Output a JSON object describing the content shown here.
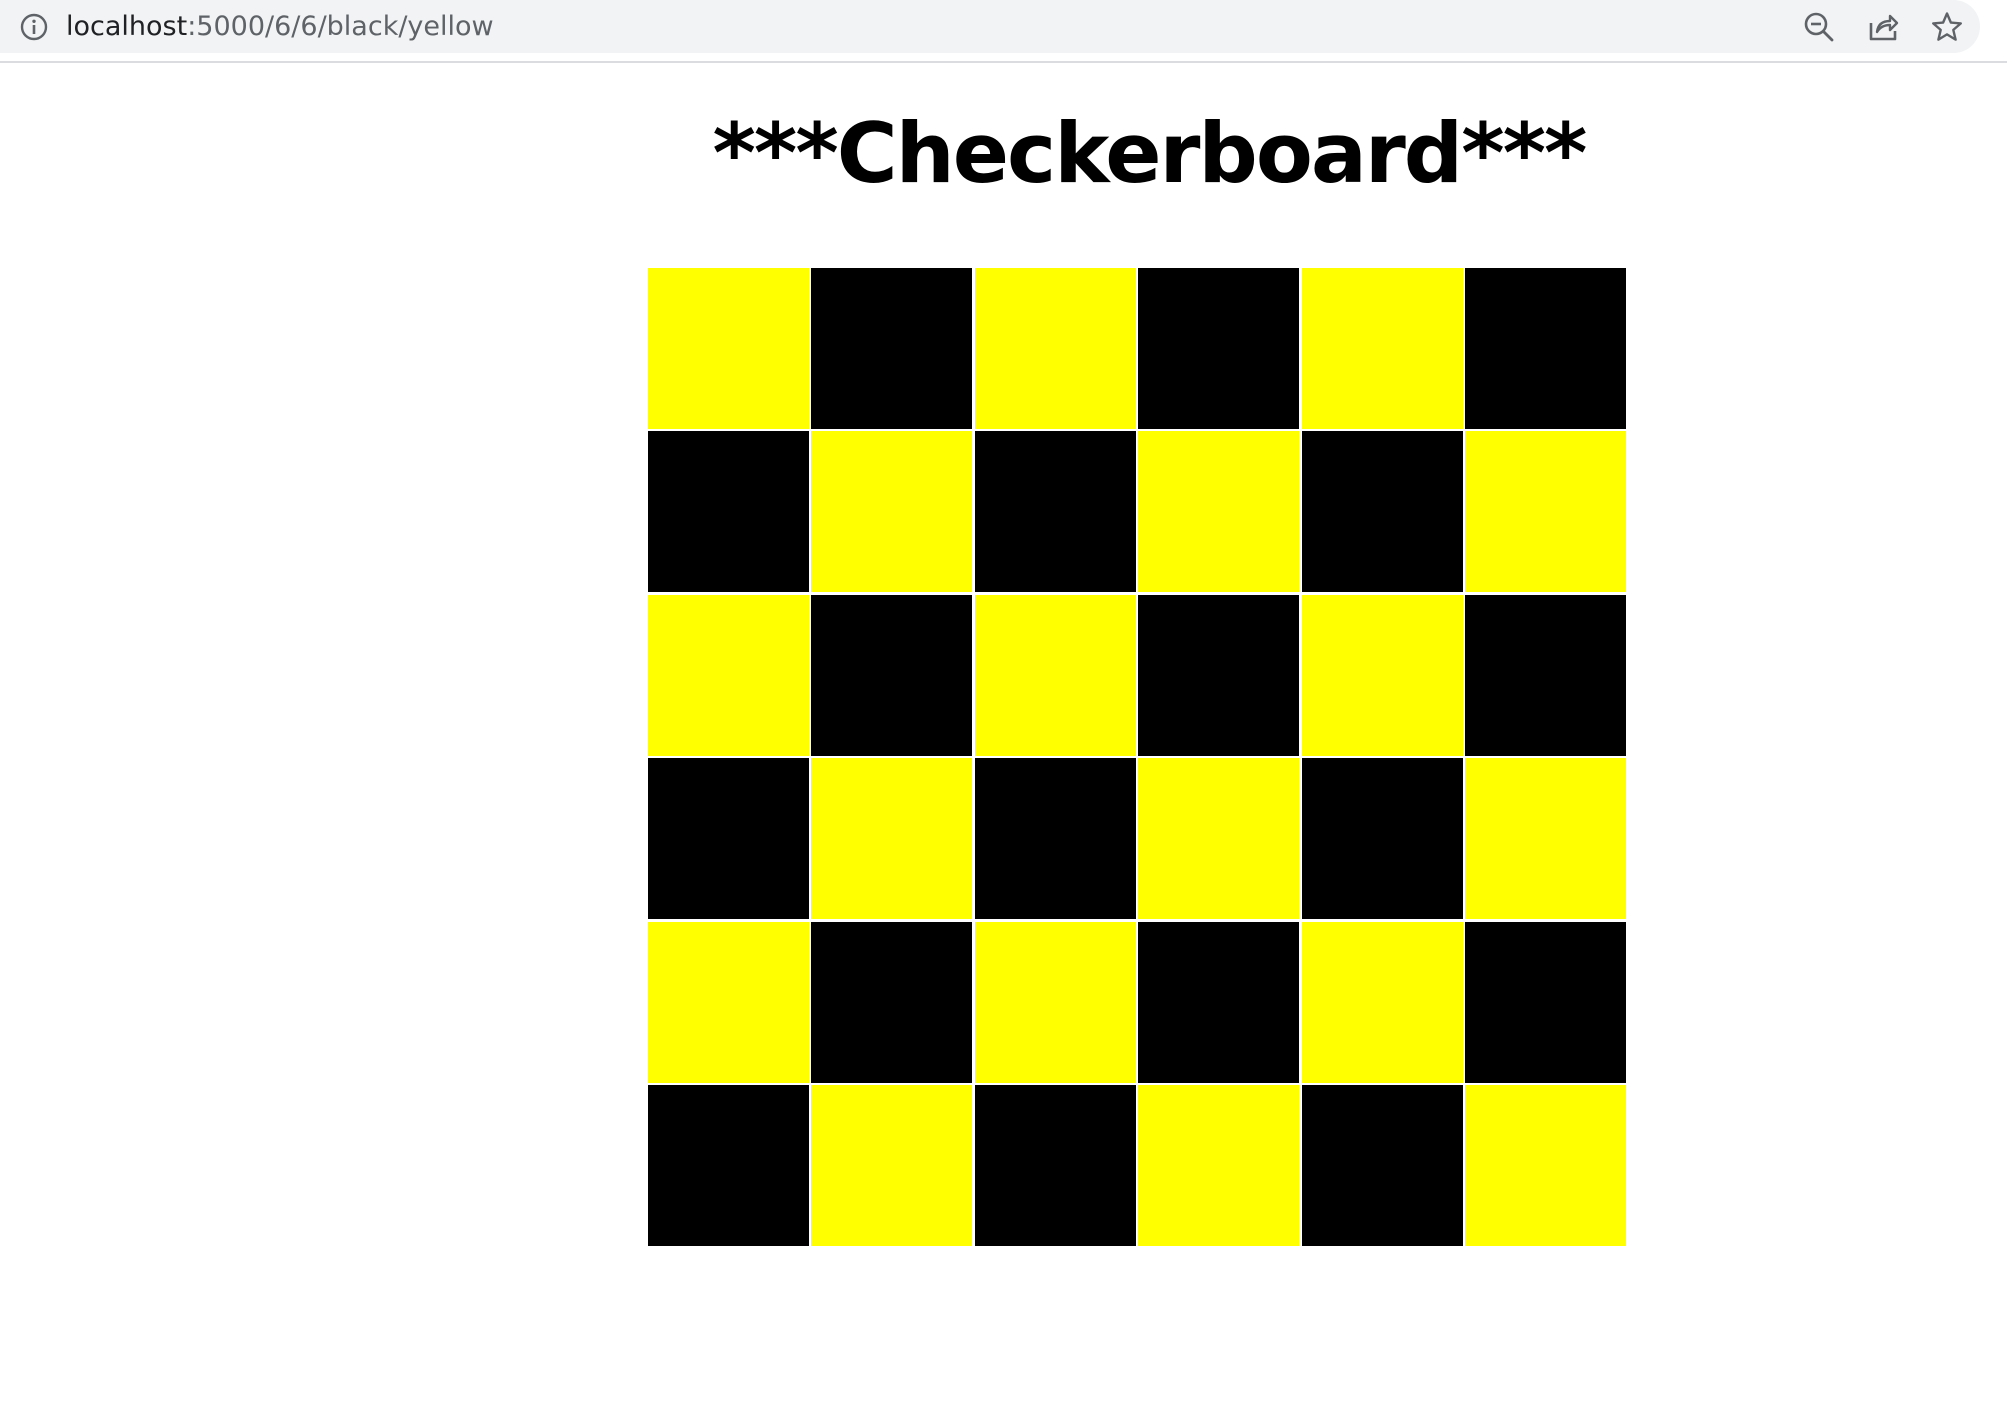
{
  "browser": {
    "url_host": "localhost",
    "url_path": ":5000/6/6/black/yellow",
    "icons": [
      "info-icon",
      "zoom-out-icon",
      "share-icon",
      "bookmark-star-icon"
    ]
  },
  "page": {
    "title": "***Checkerboard***"
  },
  "board": {
    "rows": 6,
    "cols": 6,
    "color_a": "#ffff00",
    "color_b": "#000000",
    "cells": [
      [
        "yellow",
        "black",
        "yellow",
        "black",
        "yellow",
        "black"
      ],
      [
        "black",
        "yellow",
        "black",
        "yellow",
        "black",
        "yellow"
      ],
      [
        "yellow",
        "black",
        "yellow",
        "black",
        "yellow",
        "black"
      ],
      [
        "black",
        "yellow",
        "black",
        "yellow",
        "black",
        "yellow"
      ],
      [
        "yellow",
        "black",
        "yellow",
        "black",
        "yellow",
        "black"
      ],
      [
        "black",
        "yellow",
        "black",
        "yellow",
        "black",
        "yellow"
      ]
    ]
  }
}
